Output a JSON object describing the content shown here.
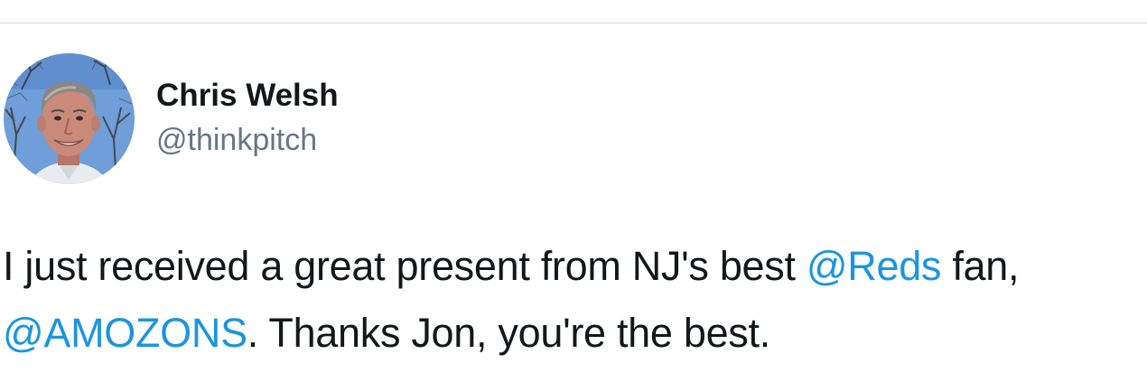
{
  "author": {
    "display_name": "Chris Welsh",
    "handle": "@thinkpitch",
    "avatar_icon": "profile-photo"
  },
  "tweet": {
    "line1": {
      "text_before": "I just received a great present from NJ's best ",
      "mention": "@Reds",
      "text_after": " fan,"
    },
    "line2": {
      "mention": "@AMOZONS",
      "text_after": ". Thanks Jon, you're the best."
    }
  },
  "colors": {
    "mention": "#1b95e0",
    "handle": "#657786",
    "text": "#14171a",
    "divider": "#d6d9dc"
  }
}
